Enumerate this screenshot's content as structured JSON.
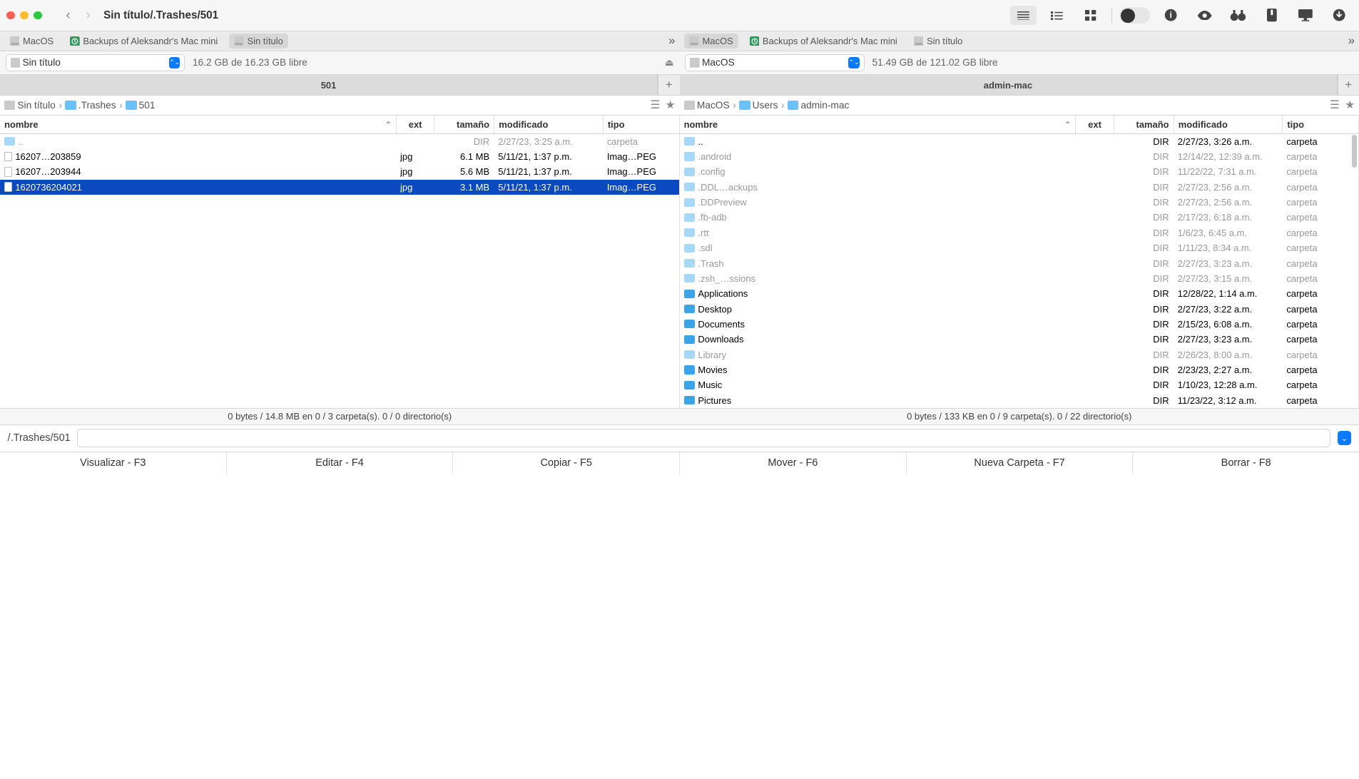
{
  "window": {
    "title": "Sin título/.Trashes/501"
  },
  "toolbar": {
    "view_list": true
  },
  "left": {
    "volumes": [
      {
        "name": "MacOS",
        "icon": "hdd"
      },
      {
        "name": "Backups of Aleksandr's Mac mini",
        "icon": "tm"
      },
      {
        "name": "Sin título",
        "icon": "hdd",
        "selected": true
      }
    ],
    "drive": {
      "name": "Sin título",
      "free": "16.2 GB de 16.23 GB libre"
    },
    "tab": "501",
    "breadcrumbs": [
      {
        "name": "Sin título",
        "icon": "hdd"
      },
      {
        "name": ".Trashes",
        "icon": "folder"
      },
      {
        "name": "501",
        "icon": "folder"
      }
    ],
    "columns": {
      "name": "nombre",
      "ext": "ext",
      "size": "tamaño",
      "mod": "modificado",
      "type": "tipo"
    },
    "rows": [
      {
        "name": "..",
        "ext": "",
        "size": "DIR",
        "mod": "2/27/23, 3:25 a.m.",
        "type": "carpeta",
        "kind": "up",
        "dim": true
      },
      {
        "name": "16207…203859",
        "ext": "jpg",
        "size": "6.1 MB",
        "mod": "5/11/21, 1:37 p.m.",
        "type": "Imag…PEG",
        "kind": "file"
      },
      {
        "name": "16207…203944",
        "ext": "jpg",
        "size": "5.6 MB",
        "mod": "5/11/21, 1:37 p.m.",
        "type": "Imag…PEG",
        "kind": "file"
      },
      {
        "name": "1620736204021",
        "ext": "jpg",
        "size": "3.1 MB",
        "mod": "5/11/21, 1:37 p.m.",
        "type": "Imag…PEG",
        "kind": "file",
        "selected": true
      }
    ],
    "status": "0 bytes / 14.8 MB en 0 / 3 carpeta(s). 0 / 0 directorio(s)"
  },
  "right": {
    "volumes": [
      {
        "name": "MacOS",
        "icon": "hdd",
        "selected": true
      },
      {
        "name": "Backups of Aleksandr's Mac mini",
        "icon": "tm"
      },
      {
        "name": "Sin título",
        "icon": "hdd"
      }
    ],
    "drive": {
      "name": "MacOS",
      "free": "51.49 GB de 121.02 GB libre"
    },
    "tab": "admin-mac",
    "breadcrumbs": [
      {
        "name": "MacOS",
        "icon": "hdd"
      },
      {
        "name": "Users",
        "icon": "folder"
      },
      {
        "name": "admin-mac",
        "icon": "folder"
      }
    ],
    "columns": {
      "name": "nombre",
      "ext": "ext",
      "size": "tamaño",
      "mod": "modificado",
      "type": "tipo"
    },
    "rows": [
      {
        "name": "..",
        "ext": "",
        "size": "DIR",
        "mod": "2/27/23, 3:26 a.m.",
        "type": "carpeta",
        "kind": "up"
      },
      {
        "name": ".android",
        "ext": "",
        "size": "DIR",
        "mod": "12/14/22, 12:39 a.m.",
        "type": "carpeta",
        "kind": "hidden"
      },
      {
        "name": ".config",
        "ext": "",
        "size": "DIR",
        "mod": "11/22/22, 7:31 a.m.",
        "type": "carpeta",
        "kind": "hidden"
      },
      {
        "name": ".DDL…ackups",
        "ext": "",
        "size": "DIR",
        "mod": "2/27/23, 2:56 a.m.",
        "type": "carpeta",
        "kind": "hidden"
      },
      {
        "name": ".DDPreview",
        "ext": "",
        "size": "DIR",
        "mod": "2/27/23, 2:56 a.m.",
        "type": "carpeta",
        "kind": "hidden"
      },
      {
        "name": ".fb-adb",
        "ext": "",
        "size": "DIR",
        "mod": "2/17/23, 6:18 a.m.",
        "type": "carpeta",
        "kind": "hidden"
      },
      {
        "name": ".rtt",
        "ext": "",
        "size": "DIR",
        "mod": "1/6/23, 6:45 a.m.",
        "type": "carpeta",
        "kind": "hidden"
      },
      {
        "name": ".sdl",
        "ext": "",
        "size": "DIR",
        "mod": "1/11/23, 8:34 a.m.",
        "type": "carpeta",
        "kind": "hidden"
      },
      {
        "name": ".Trash",
        "ext": "",
        "size": "DIR",
        "mod": "2/27/23, 3:23 a.m.",
        "type": "carpeta",
        "kind": "hidden"
      },
      {
        "name": ".zsh_…ssions",
        "ext": "",
        "size": "DIR",
        "mod": "2/27/23, 3:15 a.m.",
        "type": "carpeta",
        "kind": "hidden"
      },
      {
        "name": "Applications",
        "ext": "",
        "size": "DIR",
        "mod": "12/28/22, 1:14 a.m.",
        "type": "carpeta",
        "kind": "folder"
      },
      {
        "name": "Desktop",
        "ext": "",
        "size": "DIR",
        "mod": "2/27/23, 3:22 a.m.",
        "type": "carpeta",
        "kind": "folder"
      },
      {
        "name": "Documents",
        "ext": "",
        "size": "DIR",
        "mod": "2/15/23, 6:08 a.m.",
        "type": "carpeta",
        "kind": "folder"
      },
      {
        "name": "Downloads",
        "ext": "",
        "size": "DIR",
        "mod": "2/27/23, 3:23 a.m.",
        "type": "carpeta",
        "kind": "folder"
      },
      {
        "name": "Library",
        "ext": "",
        "size": "DIR",
        "mod": "2/26/23, 8:00 a.m.",
        "type": "carpeta",
        "kind": "hidden"
      },
      {
        "name": "Movies",
        "ext": "",
        "size": "DIR",
        "mod": "2/23/23, 2:27 a.m.",
        "type": "carpeta",
        "kind": "folder"
      },
      {
        "name": "Music",
        "ext": "",
        "size": "DIR",
        "mod": "1/10/23, 12:28 a.m.",
        "type": "carpeta",
        "kind": "folder"
      },
      {
        "name": "Pictures",
        "ext": "",
        "size": "DIR",
        "mod": "11/23/22, 3:12 a.m.",
        "type": "carpeta",
        "kind": "folder"
      }
    ],
    "status": "0 bytes / 133 KB en 0 / 9 carpeta(s). 0 / 22 directorio(s)"
  },
  "pathbar": {
    "label": "/.Trashes/501",
    "value": ""
  },
  "fnbar": [
    "Visualizar - F3",
    "Editar - F4",
    "Copiar - F5",
    "Mover - F6",
    "Nueva Carpeta - F7",
    "Borrar - F8"
  ]
}
